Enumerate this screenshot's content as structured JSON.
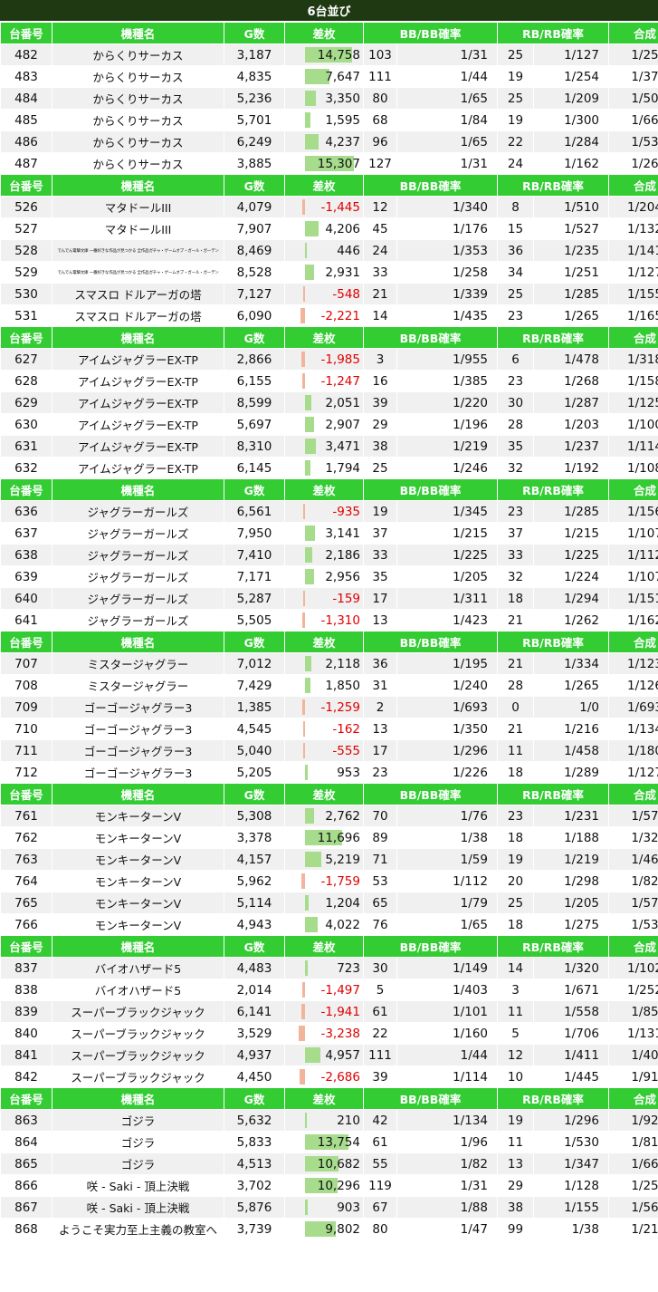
{
  "title": "6台並び",
  "headers": [
    "台番号",
    "機種名",
    "G数",
    "差枚",
    "BB/BB確率",
    "RB/RB確率",
    "合成"
  ],
  "colors": {
    "header_bg": "#33cc33",
    "title_bg": "#1f3a12",
    "positive_bar": "#a6dc8c",
    "negative_bar": "#f2b49a",
    "negative_text": "#e00000"
  },
  "groups": [
    {
      "rows": [
        {
          "no": "482",
          "name": "からくりサーカス",
          "g": "3,187",
          "diff": "14,758",
          "diff_num": 14758,
          "bb": "103",
          "bb_rate": "1/31",
          "rb": "25",
          "rb_rate": "1/127",
          "total": "1/25"
        },
        {
          "no": "483",
          "name": "からくりサーカス",
          "g": "4,835",
          "diff": "7,647",
          "diff_num": 7647,
          "bb": "111",
          "bb_rate": "1/44",
          "rb": "19",
          "rb_rate": "1/254",
          "total": "1/37"
        },
        {
          "no": "484",
          "name": "からくりサーカス",
          "g": "5,236",
          "diff": "3,350",
          "diff_num": 3350,
          "bb": "80",
          "bb_rate": "1/65",
          "rb": "25",
          "rb_rate": "1/209",
          "total": "1/50"
        },
        {
          "no": "485",
          "name": "からくりサーカス",
          "g": "5,701",
          "diff": "1,595",
          "diff_num": 1595,
          "bb": "68",
          "bb_rate": "1/84",
          "rb": "19",
          "rb_rate": "1/300",
          "total": "1/66"
        },
        {
          "no": "486",
          "name": "からくりサーカス",
          "g": "6,249",
          "diff": "4,237",
          "diff_num": 4237,
          "bb": "96",
          "bb_rate": "1/65",
          "rb": "22",
          "rb_rate": "1/284",
          "total": "1/53"
        },
        {
          "no": "487",
          "name": "からくりサーカス",
          "g": "3,885",
          "diff": "15,307",
          "diff_num": 15307,
          "bb": "127",
          "bb_rate": "1/31",
          "rb": "24",
          "rb_rate": "1/162",
          "total": "1/26"
        }
      ]
    },
    {
      "rows": [
        {
          "no": "526",
          "name": "マタドールIII",
          "g": "4,079",
          "diff": "-1,445",
          "diff_num": -1445,
          "bb": "12",
          "bb_rate": "1/340",
          "rb": "8",
          "rb_rate": "1/510",
          "total": "1/204"
        },
        {
          "no": "527",
          "name": "マタドールIII",
          "g": "7,907",
          "diff": "4,206",
          "diff_num": 4206,
          "bb": "45",
          "bb_rate": "1/176",
          "rb": "15",
          "rb_rate": "1/527",
          "total": "1/132"
        },
        {
          "no": "528",
          "name": "でんでん電撃文庫 一番好きな作品が見つかる 全作品ガチャ・ゲームオブ・ガール・ガーデン",
          "tiny": true,
          "g": "8,469",
          "diff": "446",
          "diff_num": 446,
          "bb": "24",
          "bb_rate": "1/353",
          "rb": "36",
          "rb_rate": "1/235",
          "total": "1/141"
        },
        {
          "no": "529",
          "name": "でんでん電撃文庫 一番好きな作品が見つかる 全作品ガチャ・ゲームオブ・ガール・ガーデン",
          "tiny": true,
          "g": "8,528",
          "diff": "2,931",
          "diff_num": 2931,
          "bb": "33",
          "bb_rate": "1/258",
          "rb": "34",
          "rb_rate": "1/251",
          "total": "1/127"
        },
        {
          "no": "530",
          "name": "スマスロ ドルアーガの塔",
          "g": "7,127",
          "diff": "-548",
          "diff_num": -548,
          "bb": "21",
          "bb_rate": "1/339",
          "rb": "25",
          "rb_rate": "1/285",
          "total": "1/155"
        },
        {
          "no": "531",
          "name": "スマスロ ドルアーガの塔",
          "g": "6,090",
          "diff": "-2,221",
          "diff_num": -2221,
          "bb": "14",
          "bb_rate": "1/435",
          "rb": "23",
          "rb_rate": "1/265",
          "total": "1/165"
        }
      ]
    },
    {
      "rows": [
        {
          "no": "627",
          "name": "アイムジャグラーEX-TP",
          "g": "2,866",
          "diff": "-1,985",
          "diff_num": -1985,
          "bb": "3",
          "bb_rate": "1/955",
          "rb": "6",
          "rb_rate": "1/478",
          "total": "1/318"
        },
        {
          "no": "628",
          "name": "アイムジャグラーEX-TP",
          "g": "6,155",
          "diff": "-1,247",
          "diff_num": -1247,
          "bb": "16",
          "bb_rate": "1/385",
          "rb": "23",
          "rb_rate": "1/268",
          "total": "1/158"
        },
        {
          "no": "629",
          "name": "アイムジャグラーEX-TP",
          "g": "8,599",
          "diff": "2,051",
          "diff_num": 2051,
          "bb": "39",
          "bb_rate": "1/220",
          "rb": "30",
          "rb_rate": "1/287",
          "total": "1/125"
        },
        {
          "no": "630",
          "name": "アイムジャグラーEX-TP",
          "g": "5,697",
          "diff": "2,907",
          "diff_num": 2907,
          "bb": "29",
          "bb_rate": "1/196",
          "rb": "28",
          "rb_rate": "1/203",
          "total": "1/100"
        },
        {
          "no": "631",
          "name": "アイムジャグラーEX-TP",
          "g": "8,310",
          "diff": "3,471",
          "diff_num": 3471,
          "bb": "38",
          "bb_rate": "1/219",
          "rb": "35",
          "rb_rate": "1/237",
          "total": "1/114"
        },
        {
          "no": "632",
          "name": "アイムジャグラーEX-TP",
          "g": "6,145",
          "diff": "1,794",
          "diff_num": 1794,
          "bb": "25",
          "bb_rate": "1/246",
          "rb": "32",
          "rb_rate": "1/192",
          "total": "1/108"
        }
      ]
    },
    {
      "rows": [
        {
          "no": "636",
          "name": "ジャグラーガールズ",
          "g": "6,561",
          "diff": "-935",
          "diff_num": -935,
          "bb": "19",
          "bb_rate": "1/345",
          "rb": "23",
          "rb_rate": "1/285",
          "total": "1/156"
        },
        {
          "no": "637",
          "name": "ジャグラーガールズ",
          "g": "7,950",
          "diff": "3,141",
          "diff_num": 3141,
          "bb": "37",
          "bb_rate": "1/215",
          "rb": "37",
          "rb_rate": "1/215",
          "total": "1/107"
        },
        {
          "no": "638",
          "name": "ジャグラーガールズ",
          "g": "7,410",
          "diff": "2,186",
          "diff_num": 2186,
          "bb": "33",
          "bb_rate": "1/225",
          "rb": "33",
          "rb_rate": "1/225",
          "total": "1/112"
        },
        {
          "no": "639",
          "name": "ジャグラーガールズ",
          "g": "7,171",
          "diff": "2,956",
          "diff_num": 2956,
          "bb": "35",
          "bb_rate": "1/205",
          "rb": "32",
          "rb_rate": "1/224",
          "total": "1/107"
        },
        {
          "no": "640",
          "name": "ジャグラーガールズ",
          "g": "5,287",
          "diff": "-159",
          "diff_num": -159,
          "bb": "17",
          "bb_rate": "1/311",
          "rb": "18",
          "rb_rate": "1/294",
          "total": "1/151"
        },
        {
          "no": "641",
          "name": "ジャグラーガールズ",
          "g": "5,505",
          "diff": "-1,310",
          "diff_num": -1310,
          "bb": "13",
          "bb_rate": "1/423",
          "rb": "21",
          "rb_rate": "1/262",
          "total": "1/162"
        }
      ]
    },
    {
      "rows": [
        {
          "no": "707",
          "name": "ミスタージャグラー",
          "g": "7,012",
          "diff": "2,118",
          "diff_num": 2118,
          "bb": "36",
          "bb_rate": "1/195",
          "rb": "21",
          "rb_rate": "1/334",
          "total": "1/123"
        },
        {
          "no": "708",
          "name": "ミスタージャグラー",
          "g": "7,429",
          "diff": "1,850",
          "diff_num": 1850,
          "bb": "31",
          "bb_rate": "1/240",
          "rb": "28",
          "rb_rate": "1/265",
          "total": "1/126"
        },
        {
          "no": "709",
          "name": "ゴーゴージャグラー3",
          "g": "1,385",
          "diff": "-1,259",
          "diff_num": -1259,
          "bb": "2",
          "bb_rate": "1/693",
          "rb": "0",
          "rb_rate": "1/0",
          "total": "1/693"
        },
        {
          "no": "710",
          "name": "ゴーゴージャグラー3",
          "g": "4,545",
          "diff": "-162",
          "diff_num": -162,
          "bb": "13",
          "bb_rate": "1/350",
          "rb": "21",
          "rb_rate": "1/216",
          "total": "1/134"
        },
        {
          "no": "711",
          "name": "ゴーゴージャグラー3",
          "g": "5,040",
          "diff": "-555",
          "diff_num": -555,
          "bb": "17",
          "bb_rate": "1/296",
          "rb": "11",
          "rb_rate": "1/458",
          "total": "1/180"
        },
        {
          "no": "712",
          "name": "ゴーゴージャグラー3",
          "g": "5,205",
          "diff": "953",
          "diff_num": 953,
          "bb": "23",
          "bb_rate": "1/226",
          "rb": "18",
          "rb_rate": "1/289",
          "total": "1/127"
        }
      ]
    },
    {
      "rows": [
        {
          "no": "761",
          "name": "モンキーターンV",
          "g": "5,308",
          "diff": "2,762",
          "diff_num": 2762,
          "bb": "70",
          "bb_rate": "1/76",
          "rb": "23",
          "rb_rate": "1/231",
          "total": "1/57"
        },
        {
          "no": "762",
          "name": "モンキーターンV",
          "g": "3,378",
          "diff": "11,696",
          "diff_num": 11696,
          "bb": "89",
          "bb_rate": "1/38",
          "rb": "18",
          "rb_rate": "1/188",
          "total": "1/32"
        },
        {
          "no": "763",
          "name": "モンキーターンV",
          "g": "4,157",
          "diff": "5,219",
          "diff_num": 5219,
          "bb": "71",
          "bb_rate": "1/59",
          "rb": "19",
          "rb_rate": "1/219",
          "total": "1/46"
        },
        {
          "no": "764",
          "name": "モンキーターンV",
          "g": "5,962",
          "diff": "-1,759",
          "diff_num": -1759,
          "bb": "53",
          "bb_rate": "1/112",
          "rb": "20",
          "rb_rate": "1/298",
          "total": "1/82"
        },
        {
          "no": "765",
          "name": "モンキーターンV",
          "g": "5,114",
          "diff": "1,204",
          "diff_num": 1204,
          "bb": "65",
          "bb_rate": "1/79",
          "rb": "25",
          "rb_rate": "1/205",
          "total": "1/57"
        },
        {
          "no": "766",
          "name": "モンキーターンV",
          "g": "4,943",
          "diff": "4,022",
          "diff_num": 4022,
          "bb": "76",
          "bb_rate": "1/65",
          "rb": "18",
          "rb_rate": "1/275",
          "total": "1/53"
        }
      ]
    },
    {
      "rows": [
        {
          "no": "837",
          "name": "バイオハザード5",
          "g": "4,483",
          "diff": "723",
          "diff_num": 723,
          "bb": "30",
          "bb_rate": "1/149",
          "rb": "14",
          "rb_rate": "1/320",
          "total": "1/102"
        },
        {
          "no": "838",
          "name": "バイオハザード5",
          "g": "2,014",
          "diff": "-1,497",
          "diff_num": -1497,
          "bb": "5",
          "bb_rate": "1/403",
          "rb": "3",
          "rb_rate": "1/671",
          "total": "1/252"
        },
        {
          "no": "839",
          "name": "スーパーブラックジャック",
          "g": "6,141",
          "diff": "-1,941",
          "diff_num": -1941,
          "bb": "61",
          "bb_rate": "1/101",
          "rb": "11",
          "rb_rate": "1/558",
          "total": "1/85"
        },
        {
          "no": "840",
          "name": "スーパーブラックジャック",
          "g": "3,529",
          "diff": "-3,238",
          "diff_num": -3238,
          "bb": "22",
          "bb_rate": "1/160",
          "rb": "5",
          "rb_rate": "1/706",
          "total": "1/131"
        },
        {
          "no": "841",
          "name": "スーパーブラックジャック",
          "g": "4,937",
          "diff": "4,957",
          "diff_num": 4957,
          "bb": "111",
          "bb_rate": "1/44",
          "rb": "12",
          "rb_rate": "1/411",
          "total": "1/40"
        },
        {
          "no": "842",
          "name": "スーパーブラックジャック",
          "g": "4,450",
          "diff": "-2,686",
          "diff_num": -2686,
          "bb": "39",
          "bb_rate": "1/114",
          "rb": "10",
          "rb_rate": "1/445",
          "total": "1/91"
        }
      ]
    },
    {
      "rows": [
        {
          "no": "863",
          "name": "ゴジラ",
          "g": "5,632",
          "diff": "210",
          "diff_num": 210,
          "bb": "42",
          "bb_rate": "1/134",
          "rb": "19",
          "rb_rate": "1/296",
          "total": "1/92"
        },
        {
          "no": "864",
          "name": "ゴジラ",
          "g": "5,833",
          "diff": "13,754",
          "diff_num": 13754,
          "bb": "61",
          "bb_rate": "1/96",
          "rb": "11",
          "rb_rate": "1/530",
          "total": "1/81"
        },
        {
          "no": "865",
          "name": "ゴジラ",
          "g": "4,513",
          "diff": "10,682",
          "diff_num": 10682,
          "bb": "55",
          "bb_rate": "1/82",
          "rb": "13",
          "rb_rate": "1/347",
          "total": "1/66"
        },
        {
          "no": "866",
          "name": "咲 - Saki - 頂上決戦",
          "g": "3,702",
          "diff": "10,296",
          "diff_num": 10296,
          "bb": "119",
          "bb_rate": "1/31",
          "rb": "29",
          "rb_rate": "1/128",
          "total": "1/25"
        },
        {
          "no": "867",
          "name": "咲 - Saki - 頂上決戦",
          "g": "5,876",
          "diff": "903",
          "diff_num": 903,
          "bb": "67",
          "bb_rate": "1/88",
          "rb": "38",
          "rb_rate": "1/155",
          "total": "1/56"
        },
        {
          "no": "868",
          "name": "ようこそ実力至上主義の教室へ",
          "g": "3,739",
          "diff": "9,802",
          "diff_num": 9802,
          "bb": "80",
          "bb_rate": "1/47",
          "rb": "99",
          "rb_rate": "1/38",
          "total": "1/21"
        }
      ]
    }
  ]
}
